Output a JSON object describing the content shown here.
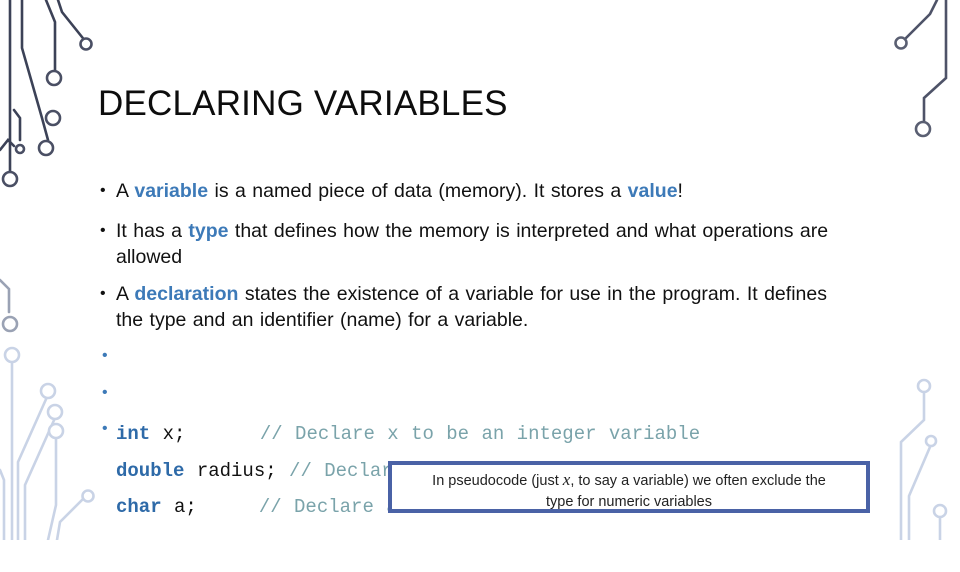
{
  "slide": {
    "title": "DECLARING VARIABLES",
    "accent_color": "#3d7ab8",
    "bullets": [
      {
        "pre": "A ",
        "kw1": "variable",
        "mid": " is a named piece of data (memory). It stores a ",
        "kw2": "value",
        "post": "!"
      },
      {
        "pre": "It has a ",
        "kw1": "type",
        "post": " that defines how the memory is interpreted and what operations are allowed"
      },
      {
        "pre": "A ",
        "kw1": "declaration",
        "post": " states the existence of a variable for use in the program. It defines the type and an identifier (name) for a variable."
      }
    ],
    "code_lines": [
      {
        "keyword": "int",
        "rest": " x;      ",
        "comment": "// Declare x to be an integer variable"
      },
      {
        "keyword": "double",
        "rest": " radius; ",
        "comment": "// Declare radius to be a double variable"
      },
      {
        "keyword": "char",
        "rest": " a;     ",
        "comment": "// Declare a to be a character variable"
      }
    ],
    "note": {
      "line1_pre": "In pseudocode (just ",
      "var": "x",
      "line1_post": ", to say a variable) we often exclude the",
      "line2": "type for numeric variables"
    },
    "bullet_glyph": "•"
  }
}
